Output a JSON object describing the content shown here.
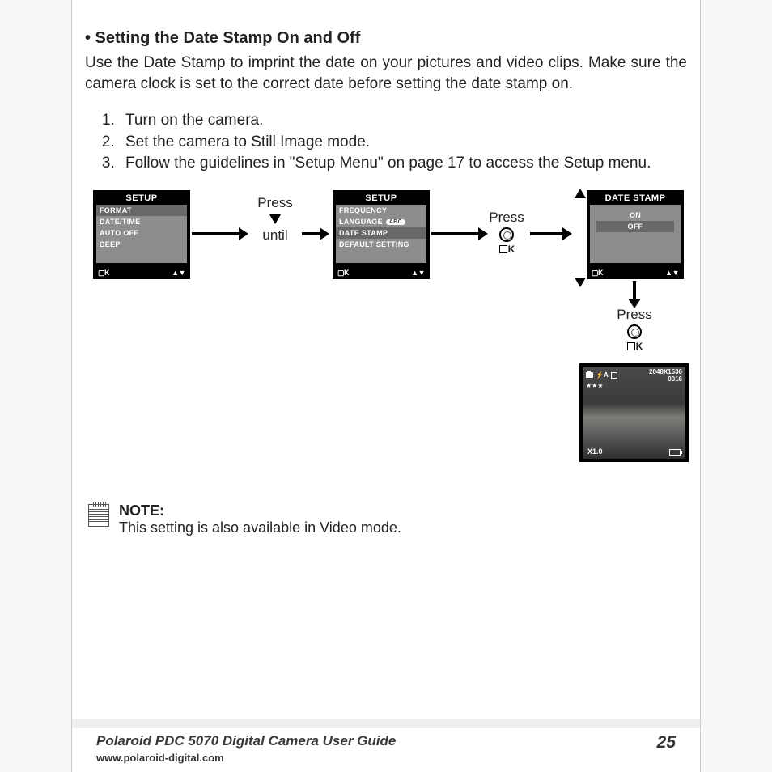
{
  "heading": "• Setting the Date Stamp On and Off",
  "intro": "Use the Date Stamp to imprint the date on your pictures and video clips. Make sure the camera clock is set to the correct date before setting the date stamp on.",
  "steps": [
    "Turn on the camera.",
    "Set the camera to Still Image mode.",
    "Follow the guidelines in \"Setup Menu\" on page 17 to access the Setup menu."
  ],
  "screens": {
    "setup1": {
      "title": "SETUP",
      "items": [
        "FORMAT",
        "DATE/TIME",
        "AUTO OFF",
        "BEEP"
      ],
      "selected": 0
    },
    "setup2": {
      "title": "SETUP",
      "items": [
        "FREQUENCY",
        "LANGUAGE",
        "DATE STAMP",
        "DEFAULT SETTING"
      ],
      "language_badge": "ABC",
      "selected": 2
    },
    "datestamp": {
      "title": "DATE STAMP",
      "items": [
        "ON",
        "OFF"
      ],
      "selected": 1
    }
  },
  "labels": {
    "press": "Press",
    "until": "until",
    "ok": "K",
    "ok_bottom": "▢K",
    "updown": "▲▼"
  },
  "preview": {
    "resolution": "2048X1536",
    "count": "0016",
    "stars": "★★★",
    "zoom": "X1.0",
    "flash_auto": "⚡A"
  },
  "note": {
    "label": "NOTE:",
    "text": "This setting is also available in Video mode."
  },
  "footer": {
    "guide": "Polaroid PDC 5070 Digital Camera User Guide",
    "url": "www.polaroid-digital.com",
    "page": "25"
  }
}
